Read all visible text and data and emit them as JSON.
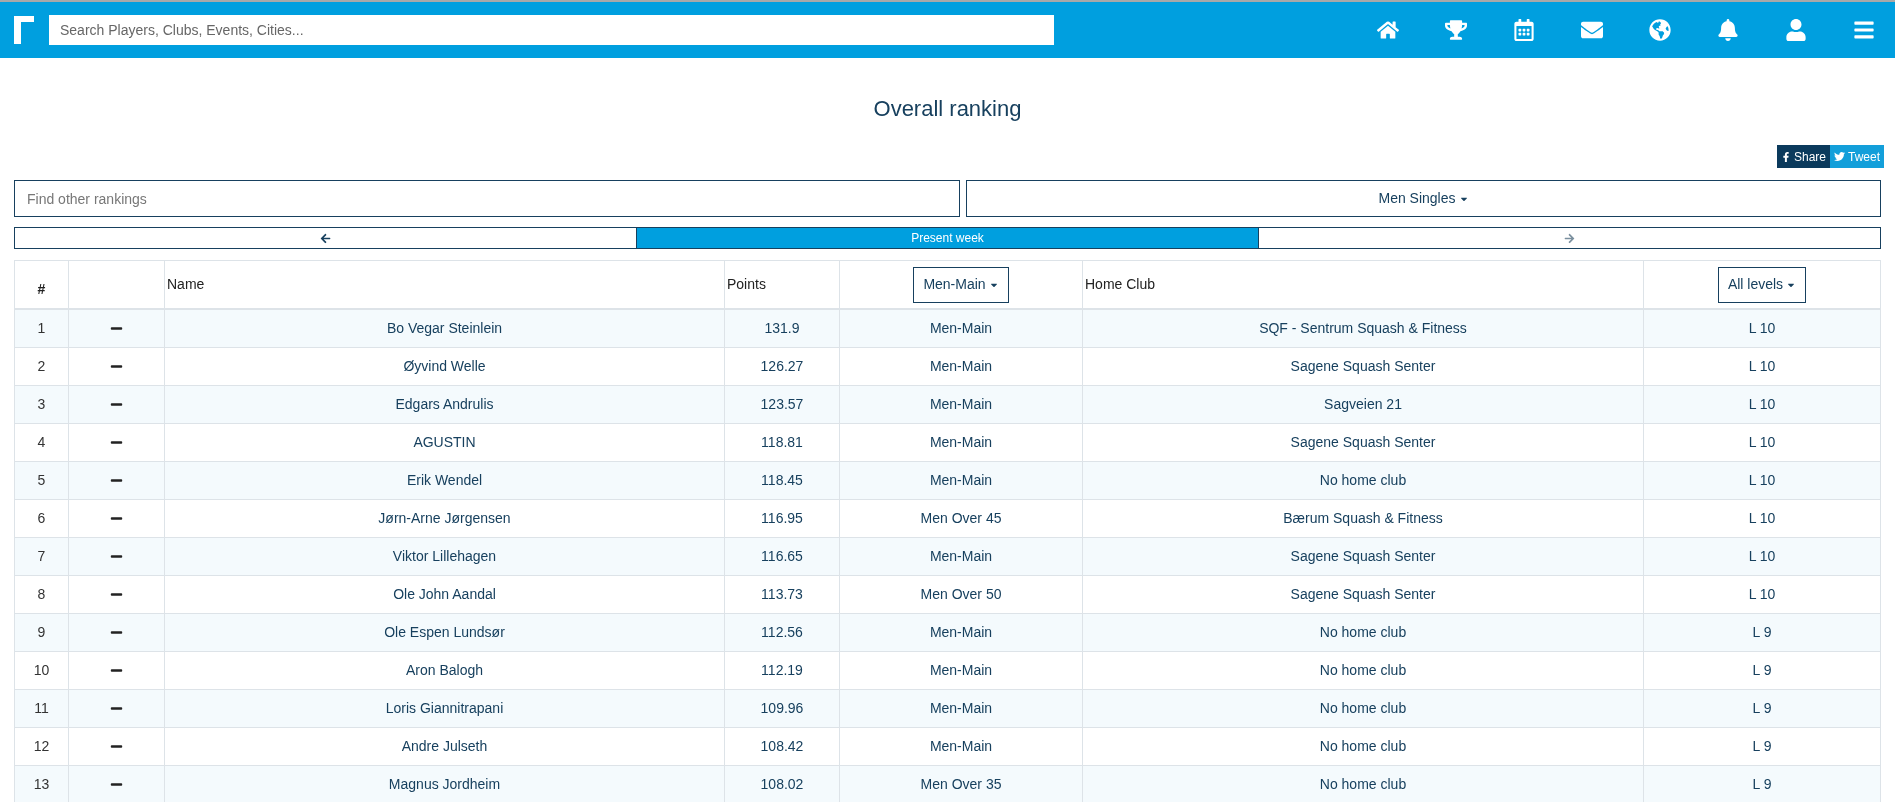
{
  "header": {
    "search": {
      "placeholder": "Search Players, Clubs, Events, Cities..."
    }
  },
  "title": "Overall ranking",
  "share": {
    "facebook": "Share",
    "twitter": "Tweet"
  },
  "ranking_search": {
    "placeholder": "Find other rankings"
  },
  "category_dropdown": "Men Singles",
  "week_nav": {
    "previous": {
      "disabled": false
    },
    "current": "Present week",
    "next": {
      "disabled": true
    }
  },
  "table": {
    "columns": {
      "rank": "#",
      "name": "Name",
      "points": "Points",
      "category_filter": "Men-Main",
      "club": "Home Club",
      "level_filter": "All levels"
    },
    "rows": [
      {
        "rank": "1",
        "name": "Bo Vegar Steinlein",
        "points": "131.9",
        "category": "Men-Main",
        "club": "SQF - Sentrum Squash & Fitness",
        "level": "L 10"
      },
      {
        "rank": "2",
        "name": "Øyvind Welle",
        "points": "126.27",
        "category": "Men-Main",
        "club": "Sagene Squash Senter",
        "level": "L 10"
      },
      {
        "rank": "3",
        "name": "Edgars Andrulis",
        "points": "123.57",
        "category": "Men-Main",
        "club": "Sagveien 21",
        "level": "L 10"
      },
      {
        "rank": "4",
        "name": "AGUSTIN",
        "points": "118.81",
        "category": "Men-Main",
        "club": "Sagene Squash Senter",
        "level": "L 10"
      },
      {
        "rank": "5",
        "name": "Erik Wendel",
        "points": "118.45",
        "category": "Men-Main",
        "club": "No home club",
        "level": "L 10"
      },
      {
        "rank": "6",
        "name": "Jørn-Arne Jørgensen",
        "points": "116.95",
        "category": "Men Over 45",
        "club": "Bærum Squash & Fitness",
        "level": "L 10"
      },
      {
        "rank": "7",
        "name": "Viktor Lillehagen",
        "points": "116.65",
        "category": "Men-Main",
        "club": "Sagene Squash Senter",
        "level": "L 10"
      },
      {
        "rank": "8",
        "name": "Ole John Aandal",
        "points": "113.73",
        "category": "Men Over 50",
        "club": "Sagene Squash Senter",
        "level": "L 10"
      },
      {
        "rank": "9",
        "name": "Ole Espen Lundsør",
        "points": "112.56",
        "category": "Men-Main",
        "club": "No home club",
        "level": "L 9"
      },
      {
        "rank": "10",
        "name": "Aron Balogh",
        "points": "112.19",
        "category": "Men-Main",
        "club": "No home club",
        "level": "L 9"
      },
      {
        "rank": "11",
        "name": "Loris Giannitrapani",
        "points": "109.96",
        "category": "Men-Main",
        "club": "No home club",
        "level": "L 9"
      },
      {
        "rank": "12",
        "name": "Andre Julseth",
        "points": "108.42",
        "category": "Men-Main",
        "club": "No home club",
        "level": "L 9"
      },
      {
        "rank": "13",
        "name": "Magnus Jordheim",
        "points": "108.02",
        "category": "Men Over 35",
        "club": "No home club",
        "level": "L 9"
      }
    ]
  }
}
